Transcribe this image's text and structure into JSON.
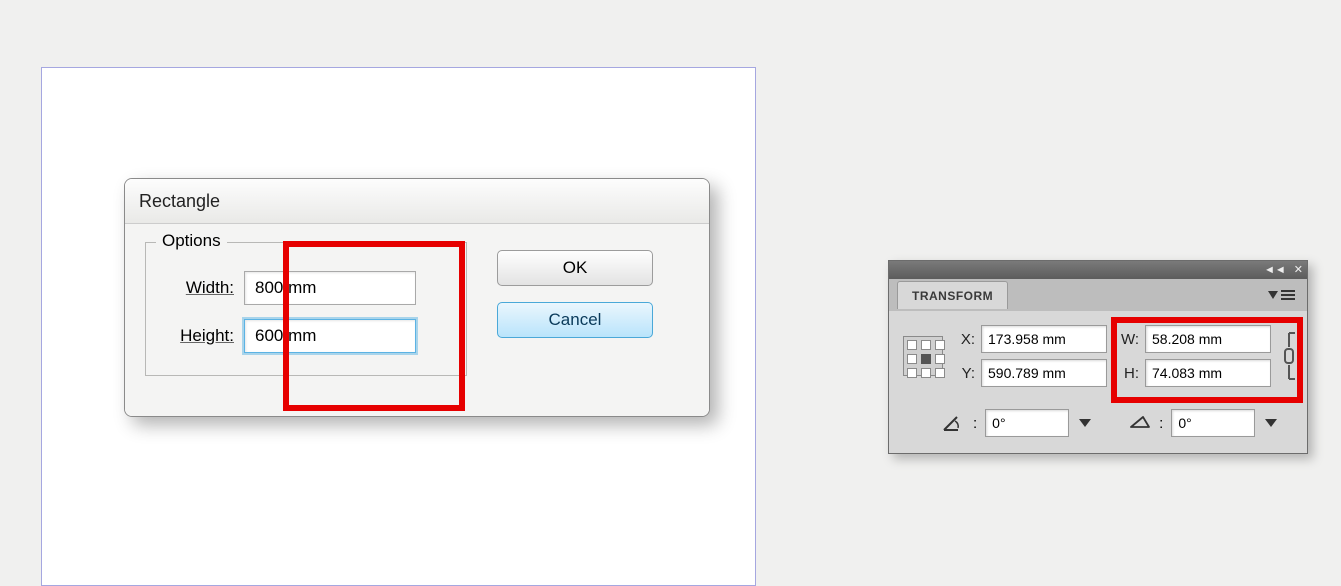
{
  "dialog": {
    "title": "Rectangle",
    "options_legend": "Options",
    "width_label": "Width:",
    "width_value": "800 mm",
    "height_label": "Height:",
    "height_value": "600 mm",
    "ok_label": "OK",
    "cancel_label": "Cancel"
  },
  "transform": {
    "tab_label": "TRANSFORM",
    "x_label": "X:",
    "x_value": "173.958 mm",
    "y_label": "Y:",
    "y_value": "590.789 mm",
    "w_label": "W:",
    "w_value": "58.208 mm",
    "h_label": "H:",
    "h_value": "74.083 mm",
    "rotate_value": "0°",
    "shear_value": "0°"
  }
}
